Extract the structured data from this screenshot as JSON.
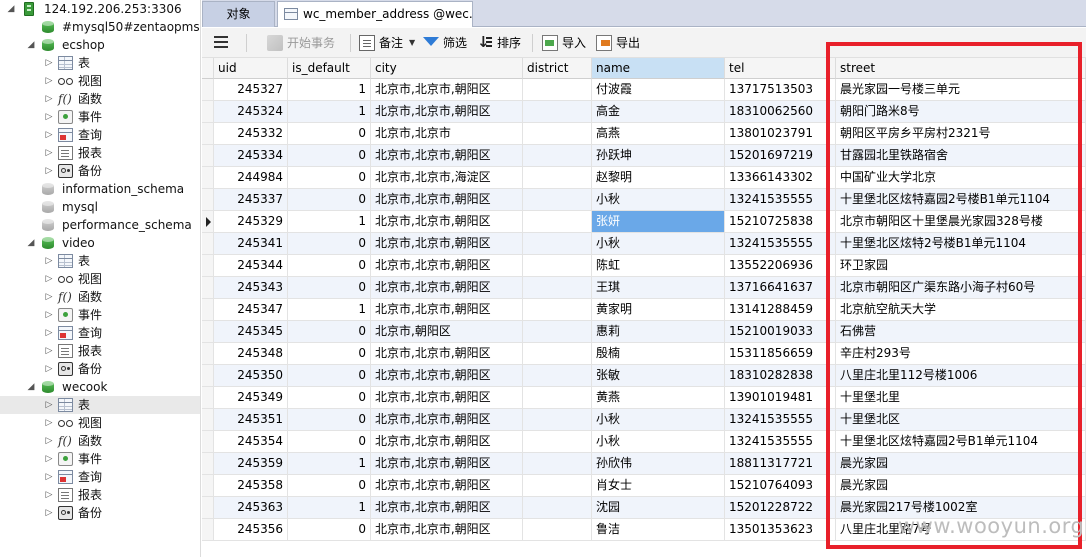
{
  "tree": [
    {
      "label": "124.192.206.253:3306",
      "icon": "server",
      "depth": 0,
      "twist": "open"
    },
    {
      "label": "#mysql50#zentaopms-c",
      "icon": "db-green",
      "depth": 1,
      "twist": ""
    },
    {
      "label": "ecshop",
      "icon": "db-green",
      "depth": 1,
      "twist": "open"
    },
    {
      "label": "表",
      "icon": "table",
      "depth": 2,
      "twist": "closed"
    },
    {
      "label": "视图",
      "icon": "view",
      "depth": 2,
      "twist": "closed"
    },
    {
      "label": "函数",
      "icon": "function",
      "depth": 2,
      "twist": "closed"
    },
    {
      "label": "事件",
      "icon": "event",
      "depth": 2,
      "twist": "closed"
    },
    {
      "label": "查询",
      "icon": "query",
      "depth": 2,
      "twist": "closed"
    },
    {
      "label": "报表",
      "icon": "report",
      "depth": 2,
      "twist": "closed"
    },
    {
      "label": "备份",
      "icon": "backup",
      "depth": 2,
      "twist": "closed"
    },
    {
      "label": "information_schema",
      "icon": "db-grey",
      "depth": 1,
      "twist": ""
    },
    {
      "label": "mysql",
      "icon": "db-grey",
      "depth": 1,
      "twist": ""
    },
    {
      "label": "performance_schema",
      "icon": "db-grey",
      "depth": 1,
      "twist": ""
    },
    {
      "label": "video",
      "icon": "db-green",
      "depth": 1,
      "twist": "open"
    },
    {
      "label": "表",
      "icon": "table",
      "depth": 2,
      "twist": "closed"
    },
    {
      "label": "视图",
      "icon": "view",
      "depth": 2,
      "twist": "closed"
    },
    {
      "label": "函数",
      "icon": "function",
      "depth": 2,
      "twist": "closed"
    },
    {
      "label": "事件",
      "icon": "event",
      "depth": 2,
      "twist": "closed"
    },
    {
      "label": "查询",
      "icon": "query",
      "depth": 2,
      "twist": "closed"
    },
    {
      "label": "报表",
      "icon": "report",
      "depth": 2,
      "twist": "closed"
    },
    {
      "label": "备份",
      "icon": "backup",
      "depth": 2,
      "twist": "closed"
    },
    {
      "label": "wecook",
      "icon": "db-green",
      "depth": 1,
      "twist": "open"
    },
    {
      "label": "表",
      "icon": "table",
      "depth": 2,
      "twist": "closed",
      "selected": true
    },
    {
      "label": "视图",
      "icon": "view",
      "depth": 2,
      "twist": "closed"
    },
    {
      "label": "函数",
      "icon": "function",
      "depth": 2,
      "twist": "closed"
    },
    {
      "label": "事件",
      "icon": "event",
      "depth": 2,
      "twist": "closed"
    },
    {
      "label": "查询",
      "icon": "query",
      "depth": 2,
      "twist": "closed"
    },
    {
      "label": "报表",
      "icon": "report",
      "depth": 2,
      "twist": "closed"
    },
    {
      "label": "备份",
      "icon": "backup",
      "depth": 2,
      "twist": "closed"
    }
  ],
  "tabs": {
    "objects": "对象",
    "table": "wc_member_address @wec..."
  },
  "toolbar": {
    "menu_icon": "hamburger-menu-icon",
    "begin_transaction": "开始事务",
    "memo": "备注",
    "filter": "筛选",
    "sort": "排序",
    "import": "导入",
    "export": "导出"
  },
  "grid": {
    "columns": [
      "uid",
      "is_default",
      "city",
      "district",
      "name",
      "tel",
      "street"
    ],
    "active_column": 4,
    "current_row": 6,
    "selected_cell": {
      "row": 6,
      "col": 4
    },
    "rows": [
      [
        "245327",
        "1",
        "北京市,北京市,朝阳区",
        "",
        "付波霞",
        "13717513503",
        "晨光家园一号楼三单元"
      ],
      [
        "245324",
        "1",
        "北京市,北京市,朝阳区",
        "",
        "高金",
        "18310062560",
        "朝阳门路米8号"
      ],
      [
        "245332",
        "0",
        "北京市,北京市",
        "",
        "高燕",
        "13801023791",
        "朝阳区平房乡平房村2321号"
      ],
      [
        "245334",
        "0",
        "北京市,北京市,朝阳区",
        "",
        "孙跃坤",
        "15201697219",
        "甘露园北里铁路宿舍"
      ],
      [
        "244984",
        "0",
        "北京市,北京市,海淀区",
        "",
        "赵黎明",
        "13366143302",
        "中国矿业大学北京"
      ],
      [
        "245337",
        "0",
        "北京市,北京市,朝阳区",
        "",
        "小秋",
        "13241535555",
        "十里堡北区炫特嘉园2号楼B1单元1104"
      ],
      [
        "245329",
        "1",
        "北京市,北京市,朝阳区",
        "",
        "张妍",
        "15210725838",
        "北京市朝阳区十里堡晨光家园328号楼"
      ],
      [
        "245341",
        "0",
        "北京市,北京市,朝阳区",
        "",
        "小秋",
        "13241535555",
        "十里堡北区炫特2号楼B1单元1104"
      ],
      [
        "245344",
        "0",
        "北京市,北京市,朝阳区",
        "",
        "陈虹",
        "13552206936",
        "环卫家园"
      ],
      [
        "245343",
        "0",
        "北京市,北京市,朝阳区",
        "",
        "王琪",
        "13716641637",
        "北京市朝阳区广渠东路小海子村60号"
      ],
      [
        "245347",
        "1",
        "北京市,北京市,朝阳区",
        "",
        "黄家明",
        "13141288459",
        "北京航空航天大学"
      ],
      [
        "245345",
        "0",
        "北京市,朝阳区",
        "",
        "惠莉",
        "15210019033",
        "石佛营"
      ],
      [
        "245348",
        "0",
        "北京市,北京市,朝阳区",
        "",
        "殷楠",
        "15311856659",
        "辛庄村293号"
      ],
      [
        "245350",
        "0",
        "北京市,北京市,朝阳区",
        "",
        "张敏",
        "18310282838",
        "八里庄北里112号楼1006"
      ],
      [
        "245349",
        "0",
        "北京市,北京市,朝阳区",
        "",
        "黄燕",
        "13901019481",
        "十里堡北里"
      ],
      [
        "245351",
        "0",
        "北京市,北京市,朝阳区",
        "",
        "小秋",
        "13241535555",
        "十里堡北区"
      ],
      [
        "245354",
        "0",
        "北京市,北京市,朝阳区",
        "",
        "小秋",
        "13241535555",
        "十里堡北区炫特嘉园2号B1单元1104"
      ],
      [
        "245359",
        "1",
        "北京市,北京市,朝阳区",
        "",
        "孙欣伟",
        "18811317721",
        "晨光家园"
      ],
      [
        "245358",
        "0",
        "北京市,北京市,朝阳区",
        "",
        "肖女士",
        "15210764093",
        "晨光家园"
      ],
      [
        "245363",
        "1",
        "北京市,北京市,朝阳区",
        "",
        "沈园",
        "15201228722",
        "晨光家园217号楼1002室"
      ],
      [
        "245356",
        "0",
        "北京市,北京市,朝阳区",
        "",
        "鲁洁",
        "13501353623",
        "八里庄北里路7号"
      ]
    ]
  },
  "watermark": "www.wooyun.org",
  "colors": {
    "highlight_box": "#e8202a",
    "selected_cell": "#6aa8e8"
  }
}
